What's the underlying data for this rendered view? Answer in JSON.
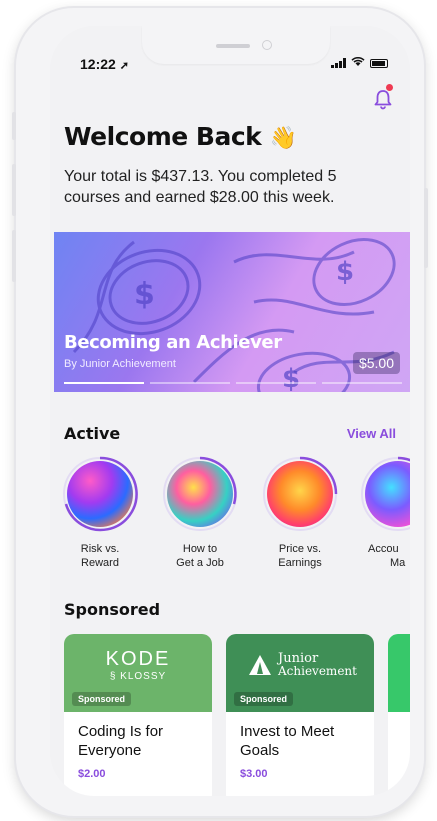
{
  "status": {
    "time": "12:22",
    "nav_icon": "location-arrow-icon"
  },
  "header": {
    "title": "Welcome Back",
    "wave_emoji": "👋",
    "summary": "Your total is $437.13. You completed 5 courses and earned $28.00 this week.",
    "notification_color": "#ef3a52"
  },
  "hero": {
    "title": "Becoming an Achiever",
    "author": "By Junior Achievement",
    "price": "$5.00",
    "slide_index": 1,
    "slide_count": 4
  },
  "active": {
    "title": "Active",
    "view_all": "View All",
    "courses": [
      {
        "line1": "Risk vs.",
        "line2": "Reward"
      },
      {
        "line1": "How to",
        "line2": "Get a Job"
      },
      {
        "line1": "Price vs.",
        "line2": "Earnings"
      },
      {
        "line1": "Accou",
        "line2": "Ma"
      }
    ]
  },
  "sponsored": {
    "title": "Sponsored",
    "badge": "Sponsored",
    "cards": [
      {
        "brand_line1": "KODE",
        "brand_line2": "§ KLOSSY",
        "title_line1": "Coding Is for",
        "title_line2": "Everyone",
        "price": "$2.00",
        "color": "#6cb46a"
      },
      {
        "brand_line1": "Junior",
        "brand_line2": "Achievement",
        "title_line1": "Invest to Meet",
        "title_line2": "Goals",
        "price": "$3.00",
        "color": "#3f8f56"
      }
    ]
  },
  "accent_color": "#8a4ddd"
}
